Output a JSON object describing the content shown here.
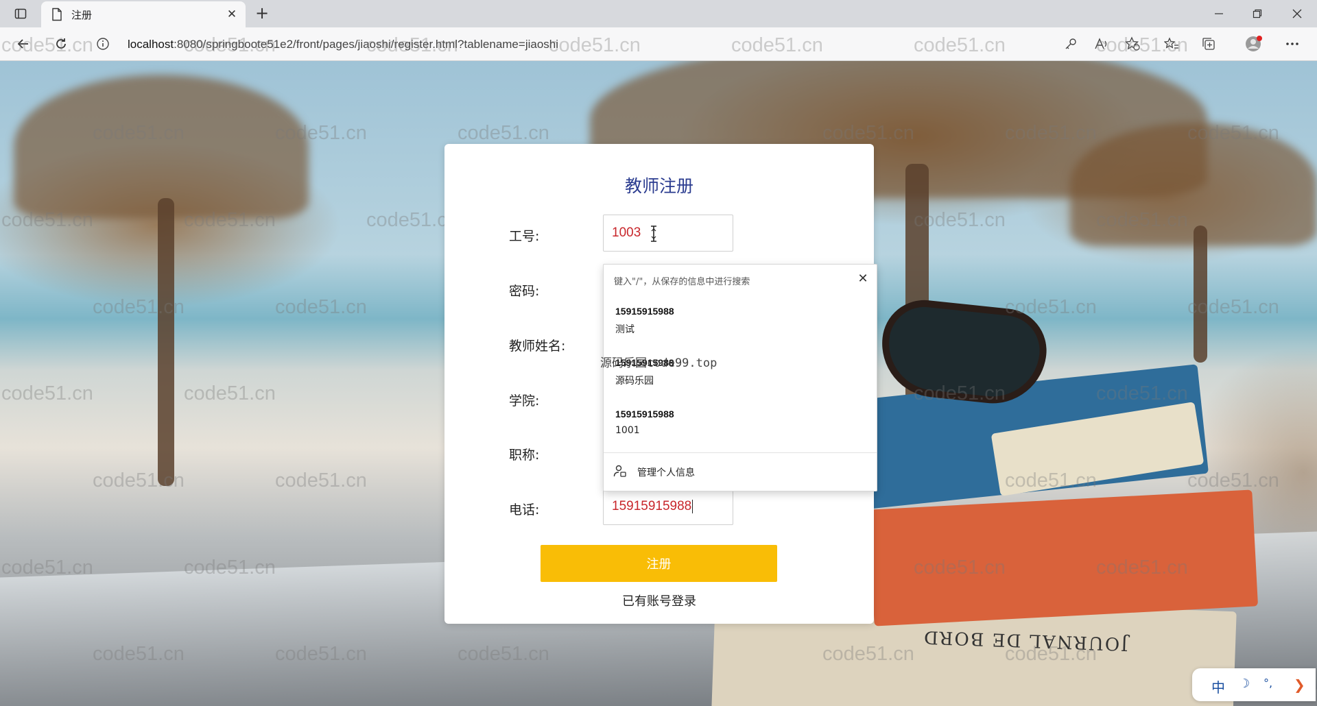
{
  "browser": {
    "tab_title": "注册",
    "new_tab": "+",
    "address": {
      "host": "localhost",
      "rest": ":8080/springboote51e2/front/pages/jiaoshi/register.html?tablename=jiaoshi"
    }
  },
  "watermark": "code51.cn",
  "book_spine_text": "JOURNAL DE BORD",
  "form": {
    "title": "教师注册",
    "fields": [
      {
        "label": "工号:",
        "value": "1003"
      },
      {
        "label": "密码:",
        "value": ""
      },
      {
        "label": "教师姓名:",
        "value": ""
      },
      {
        "label": "学院:",
        "value": ""
      },
      {
        "label": "职称:",
        "value": ""
      },
      {
        "label": "电话:",
        "value": "15915915988"
      }
    ],
    "submit_label": "注册",
    "login_link": "已有账号登录"
  },
  "autofill": {
    "hint": "键入\"/\"，从保存的信息中进行搜索",
    "items": [
      {
        "value": "15915915988",
        "desc": "测试"
      },
      {
        "value": "15915915988",
        "desc": "源码乐园"
      },
      {
        "value": "15915915988",
        "desc": "1001"
      }
    ],
    "manage_label": "管理个人信息"
  },
  "overlay_text": "源码乐园code99.top",
  "ime": {
    "lang": "中",
    "mode": "☽",
    "punct": "°,",
    "arrow": "❯"
  },
  "colors": {
    "submit": "#f9bd06",
    "title": "#2a3b8f",
    "value": "#c8262b"
  }
}
